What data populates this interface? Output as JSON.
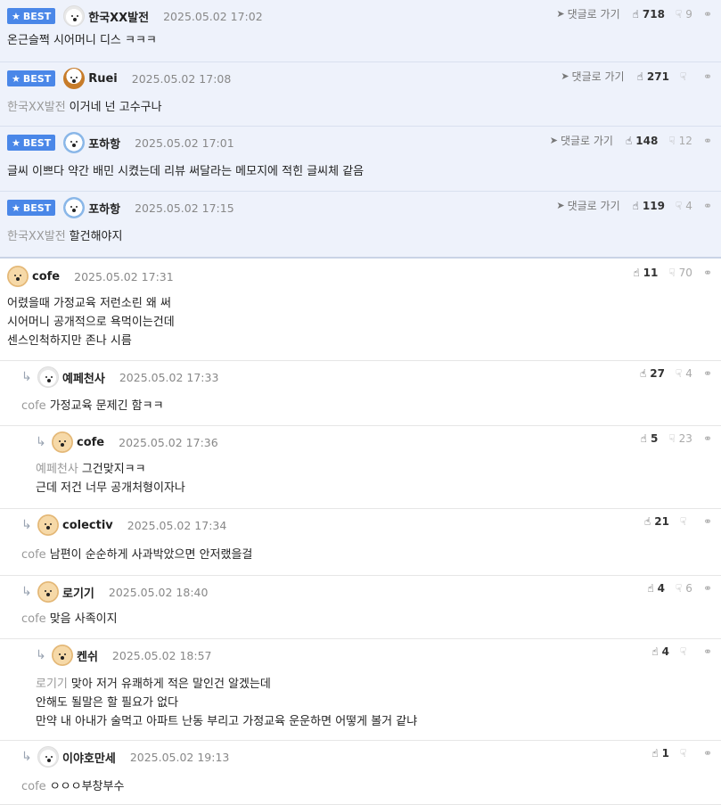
{
  "labels": {
    "best": "BEST",
    "goto": "댓글로 가기"
  },
  "comments": [
    {
      "best": true,
      "nick": "한국XX발전",
      "date": "2025.05.02 17:02",
      "avatar": "dog-white",
      "likes": "718",
      "dislikes": "9",
      "lines": [
        "온근슬쩍 시어머니 디스 ㅋㅋㅋ"
      ],
      "mention": ""
    },
    {
      "best": true,
      "nick": "Ruei",
      "date": "2025.05.02 17:08",
      "avatar": "dog-brown",
      "likes": "271",
      "dislikes": "",
      "mention": "한국XX발전",
      "lines": [
        "이거네 넌 고수구나"
      ]
    },
    {
      "best": true,
      "nick": "포하항",
      "date": "2025.05.02 17:01",
      "avatar": "bear",
      "likes": "148",
      "dislikes": "12",
      "mention": "",
      "lines": [
        "글씨 이쁘다 약간 배민 시켰는데 리뷰 써달라는 메모지에 적힌 글씨체 같음"
      ]
    },
    {
      "best": true,
      "nick": "포하항",
      "date": "2025.05.02 17:15",
      "avatar": "bear",
      "likes": "119",
      "dislikes": "4",
      "mention": "한국XX발전",
      "lines": [
        "할건해야지"
      ]
    },
    {
      "best": false,
      "nick": "cofe",
      "date": "2025.05.02 17:31",
      "avatar": "dog-yellow",
      "likes": "11",
      "dislikes": "70",
      "mention": "",
      "lines": [
        "어렸을때 가정교육 저런소린 왜 써",
        "시어머니 공개적으로 욕먹이는건데",
        "센스인척하지만 존나 시름"
      ]
    },
    {
      "best": false,
      "nick": "예페천사",
      "date": "2025.05.02 17:33",
      "avatar": "dog-white",
      "likes": "27",
      "dislikes": "4",
      "mention": "cofe",
      "lines": [
        "가정교육 문제긴 함ㅋㅋ"
      ]
    },
    {
      "best": false,
      "nick": "cofe",
      "date": "2025.05.02 17:36",
      "avatar": "dog-yellow",
      "likes": "5",
      "dislikes": "23",
      "mention": "예페천사",
      "lines": [
        "그건맞지ㅋㅋ",
        "근데 저건 너무 공개처형이자나"
      ]
    },
    {
      "best": false,
      "nick": "colectiv",
      "date": "2025.05.02 17:34",
      "avatar": "dog-yellow",
      "likes": "21",
      "dislikes": "",
      "mention": "cofe",
      "lines": [
        "남편이 순순하게 사과박았으면 안저랬을걸"
      ]
    },
    {
      "best": false,
      "nick": "로기기",
      "date": "2025.05.02 18:40",
      "avatar": "dog-yellow",
      "likes": "4",
      "dislikes": "6",
      "mention": "cofe",
      "lines": [
        "맞음 사족이지"
      ]
    },
    {
      "best": false,
      "nick": "켄쉬",
      "date": "2025.05.02 18:57",
      "avatar": "dog-yellow",
      "likes": "4",
      "dislikes": "",
      "mention": "로기기",
      "lines": [
        "맞아 저거 유쾌하게 적은 말인건 알겠는데",
        "안해도 될말은 할 필요가 없다",
        "만약 내 아내가 술먹고 아파트 난동 부리고 가정교육 운운하면 어떻게 볼거 같냐"
      ]
    },
    {
      "best": false,
      "nick": "이야호만세",
      "date": "2025.05.02 19:13",
      "avatar": "dog-white",
      "likes": "1",
      "dislikes": "",
      "mention": "cofe",
      "lines": [
        "ㅇㅇㅇ부창부수"
      ]
    }
  ]
}
